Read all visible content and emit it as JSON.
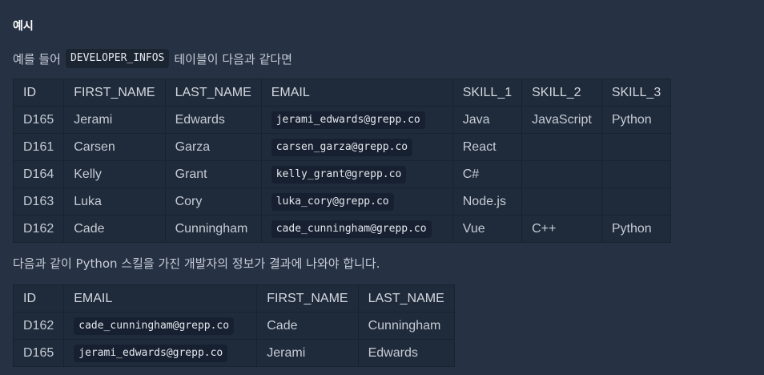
{
  "heading": "예시",
  "intro": {
    "prefix": "예를 들어",
    "code": "DEVELOPER_INFOS",
    "suffix": "테이블이 다음과 같다면"
  },
  "table1": {
    "headers": [
      "ID",
      "FIRST_NAME",
      "LAST_NAME",
      "EMAIL",
      "SKILL_1",
      "SKILL_2",
      "SKILL_3"
    ],
    "rows": [
      [
        "D165",
        "Jerami",
        "Edwards",
        "jerami_edwards@grepp.co",
        "Java",
        "JavaScript",
        "Python"
      ],
      [
        "D161",
        "Carsen",
        "Garza",
        "carsen_garza@grepp.co",
        "React",
        "",
        ""
      ],
      [
        "D164",
        "Kelly",
        "Grant",
        "kelly_grant@grepp.co",
        "C#",
        "",
        ""
      ],
      [
        "D163",
        "Luka",
        "Cory",
        "luka_cory@grepp.co",
        "Node.js",
        "",
        ""
      ],
      [
        "D162",
        "Cade",
        "Cunningham",
        "cade_cunningham@grepp.co",
        "Vue",
        "C++",
        "Python"
      ]
    ]
  },
  "description": "다음과 같이 Python 스킬을 가진 개발자의 정보가 결과에 나와야 합니다.",
  "table2": {
    "headers": [
      "ID",
      "EMAIL",
      "FIRST_NAME",
      "LAST_NAME"
    ],
    "rows": [
      [
        "D162",
        "cade_cunningham@grepp.co",
        "Cade",
        "Cunningham"
      ],
      [
        "D165",
        "jerami_edwards@grepp.co",
        "Jerami",
        "Edwards"
      ]
    ]
  }
}
